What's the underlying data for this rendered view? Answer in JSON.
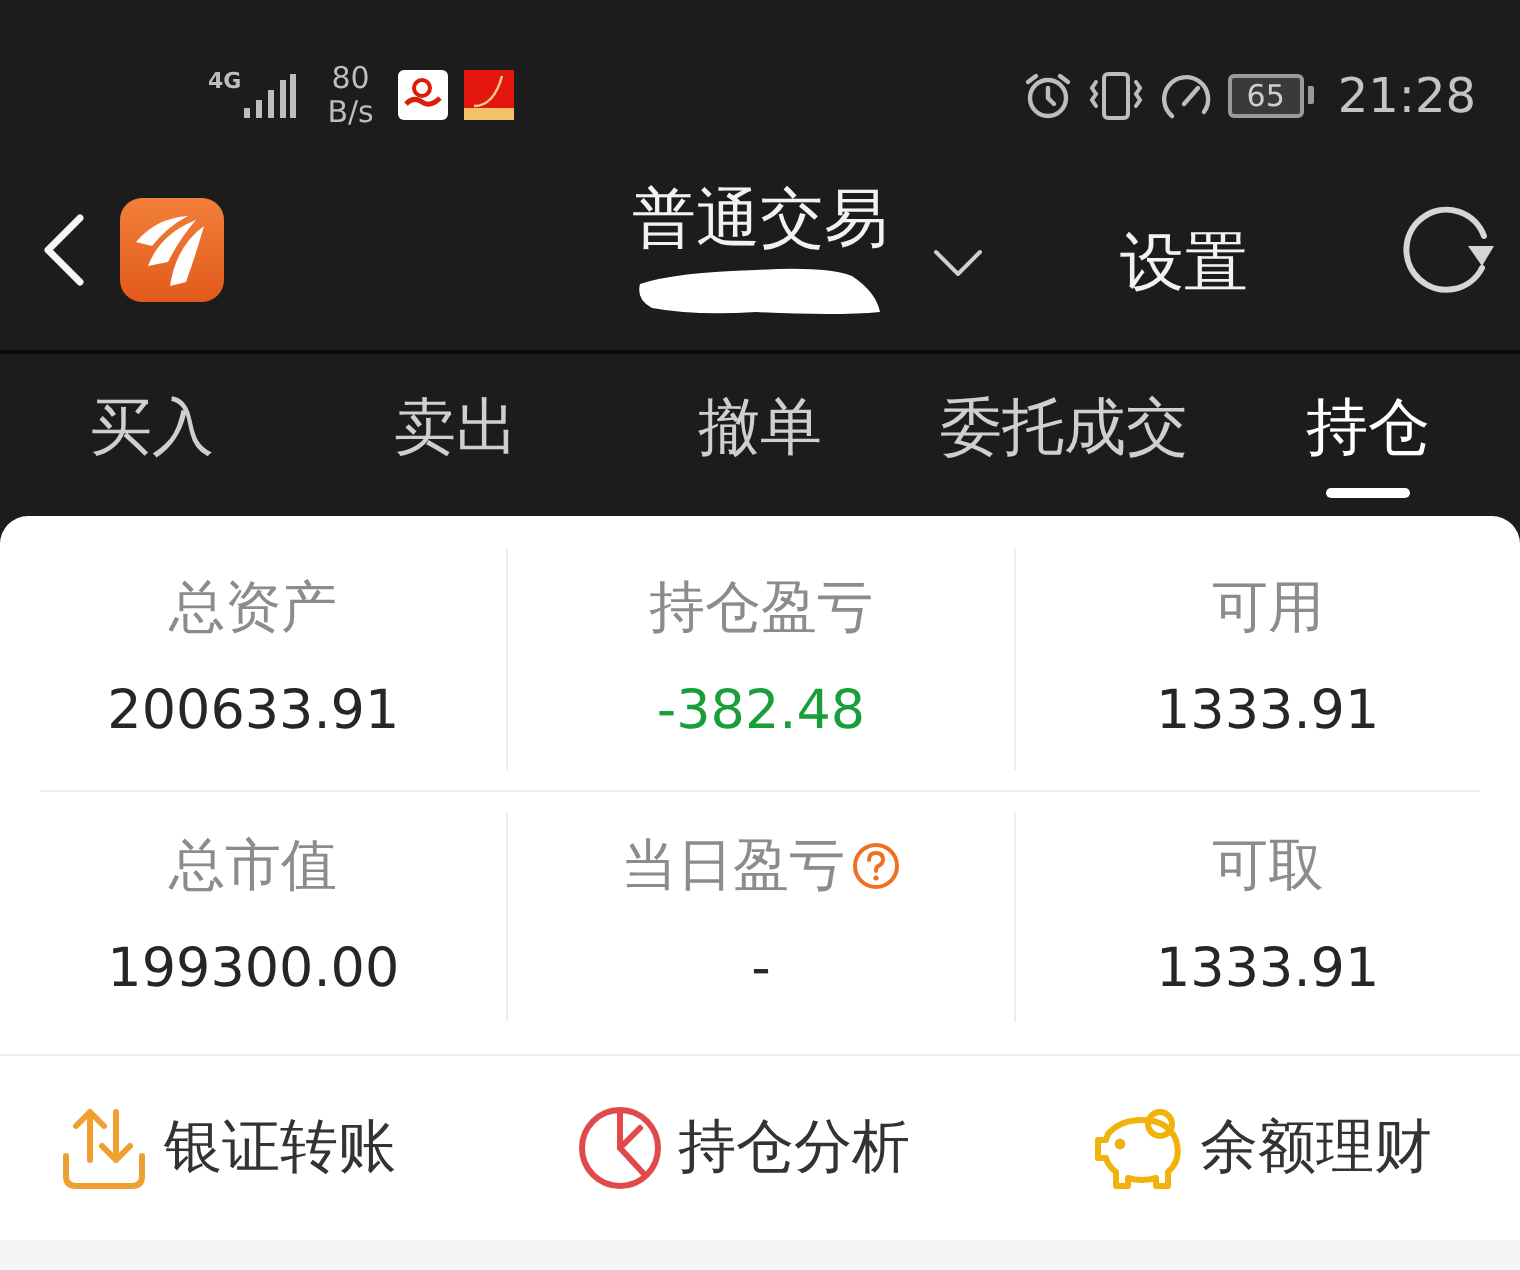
{
  "status_bar": {
    "network": "4G",
    "speed_value": "80",
    "speed_unit": "B/s",
    "battery": "65",
    "time": "21:28"
  },
  "header": {
    "title": "普通交易",
    "settings": "设置"
  },
  "tabs": [
    {
      "label": "买入",
      "selected": false
    },
    {
      "label": "卖出",
      "selected": false
    },
    {
      "label": "撤单",
      "selected": false
    },
    {
      "label": "委托成交",
      "selected": false
    },
    {
      "label": "持仓",
      "selected": true
    }
  ],
  "summary": [
    {
      "label": "总资产",
      "value": "200633.91",
      "negative": false,
      "help": false
    },
    {
      "label": "持仓盈亏",
      "value": "-382.48",
      "negative": true,
      "help": false
    },
    {
      "label": "可用",
      "value": "1333.91",
      "negative": false,
      "help": false
    },
    {
      "label": "总市值",
      "value": "199300.00",
      "negative": false,
      "help": false
    },
    {
      "label": "当日盈亏",
      "value": "-",
      "negative": false,
      "help": true
    },
    {
      "label": "可取",
      "value": "1333.91",
      "negative": false,
      "help": false
    }
  ],
  "actions": [
    {
      "label": "银证转账",
      "kind": "transfer"
    },
    {
      "label": "持仓分析",
      "kind": "analysis"
    },
    {
      "label": "余额理财",
      "kind": "savings"
    }
  ]
}
